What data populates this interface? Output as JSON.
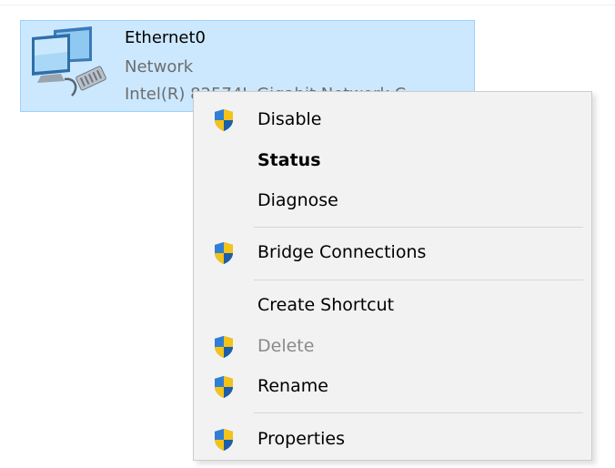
{
  "adapter": {
    "name": "Ethernet0",
    "type": "Network",
    "device": "Intel(R) 82574L Gigabit Network C",
    "icon": "network-adapter-icon"
  },
  "context_menu": {
    "items": [
      {
        "label": "Disable",
        "icon": "uac-shield-icon"
      },
      {
        "label": "Status",
        "style": "bold"
      },
      {
        "label": "Diagnose"
      },
      {
        "label": "Bridge Connections",
        "icon": "uac-shield-icon"
      },
      {
        "label": "Create Shortcut"
      },
      {
        "label": "Delete",
        "icon": "uac-shield-icon",
        "state": "disabled"
      },
      {
        "label": "Rename",
        "icon": "uac-shield-icon"
      },
      {
        "label": "Properties",
        "icon": "uac-shield-icon"
      }
    ]
  },
  "colors": {
    "selection_bg": "#cce8ff",
    "selection_border": "#99d1ff",
    "menu_bg": "#f2f2f2",
    "disabled_text": "#8a8a8a"
  }
}
